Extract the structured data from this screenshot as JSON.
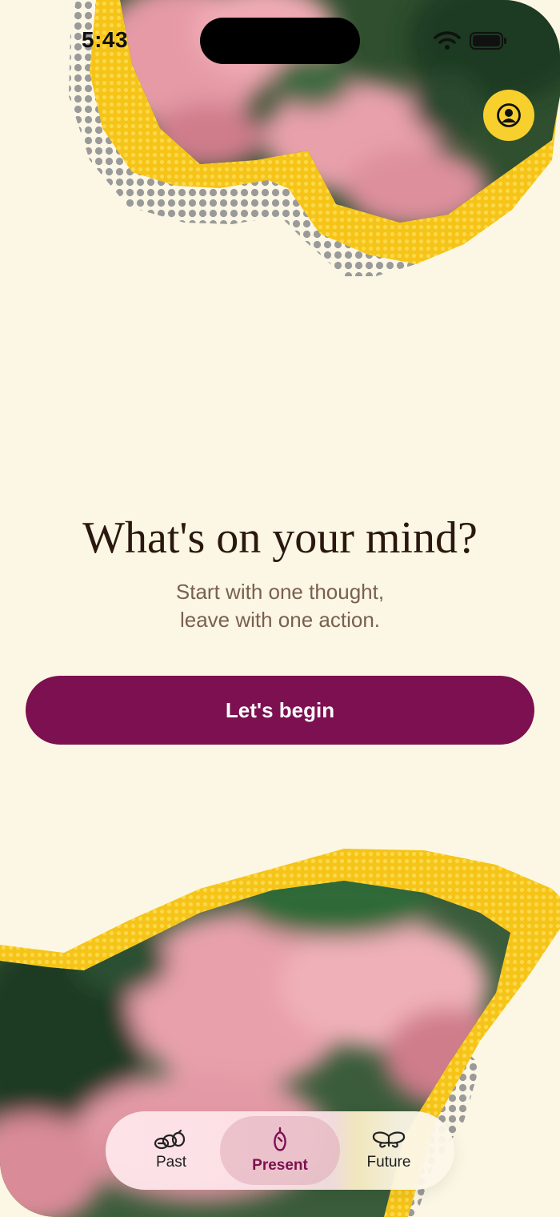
{
  "status_bar": {
    "time": "5:43"
  },
  "main": {
    "headline": "What's on your mind?",
    "subtitle_line1": "Start with one thought,",
    "subtitle_line2": "leave with one action.",
    "cta_label": "Let's begin"
  },
  "tabbar": {
    "tabs": [
      {
        "label": "Past",
        "icon": "cocoon-cluster-icon",
        "active": false
      },
      {
        "label": "Present",
        "icon": "chrysalis-icon",
        "active": true
      },
      {
        "label": "Future",
        "icon": "butterfly-icon",
        "active": false
      }
    ]
  },
  "colors": {
    "background": "#fbf7e4",
    "accent": "#7d1050",
    "yellow": "#f7d02e",
    "text_dark": "#2a1810",
    "text_muted": "#7a6050"
  }
}
